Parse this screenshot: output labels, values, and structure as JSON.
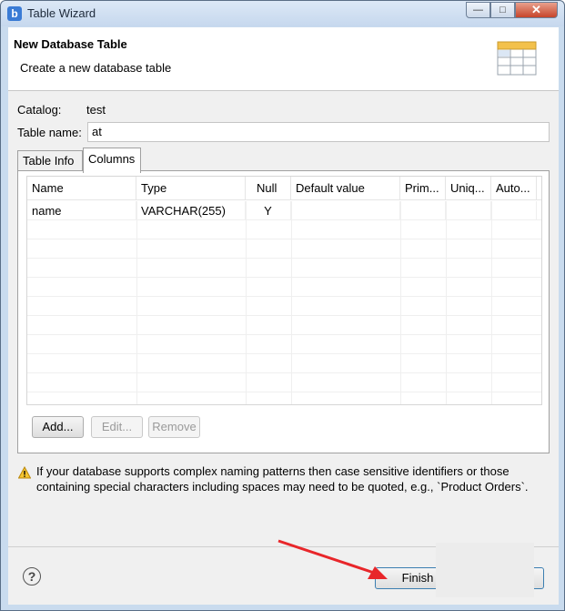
{
  "window": {
    "title": "Table Wizard",
    "min": "—",
    "max": "□",
    "close": "✕",
    "app_icon": "b"
  },
  "header": {
    "title": "New Database Table",
    "description": "Create a new database table",
    "icon": "table-icon"
  },
  "form": {
    "catalog_label": "Catalog:",
    "catalog_value": "test",
    "table_name_label": "Table name:",
    "table_name_value": "at"
  },
  "tabs": [
    {
      "label": "Table Info",
      "active": false
    },
    {
      "label": "Columns",
      "active": true
    }
  ],
  "columns_table": {
    "headers": [
      "Name",
      "Type",
      "Null",
      "Default value",
      "Prim...",
      "Uniq...",
      "Auto..."
    ],
    "rows": [
      [
        "name",
        "VARCHAR(255)",
        "Y",
        "",
        "",
        "",
        ""
      ]
    ]
  },
  "table_buttons": {
    "add": "Add...",
    "edit": "Edit...",
    "remove": "Remove"
  },
  "warning": {
    "icon": "warning-icon",
    "text": "If your database supports complex naming patterns then case sensitive identifiers or those containing special characters including spaces may need to be quoted, e.g., `Product Orders`."
  },
  "footer": {
    "help": "?",
    "finish": "Finish"
  },
  "colors": {
    "annotation_arrow": "#e8262a",
    "title_bar": "#c6d8ee"
  }
}
